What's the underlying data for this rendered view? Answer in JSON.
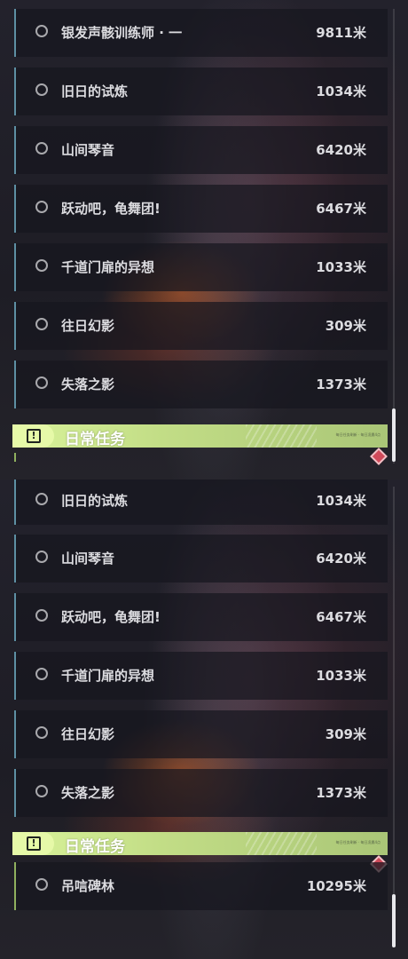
{
  "distance_unit": "米",
  "top_panel": {
    "quests": [
      {
        "name": "银发声骸训练师 · 一",
        "distance": "9811米"
      },
      {
        "name": "旧日的试炼",
        "distance": "1034米"
      },
      {
        "name": "山间琴音",
        "distance": "6420米"
      },
      {
        "name": "跃动吧，龟舞团!",
        "distance": "6467米"
      },
      {
        "name": "千道门扉的异想",
        "distance": "1033米"
      },
      {
        "name": "往日幻影",
        "distance": "309米"
      },
      {
        "name": "失落之影",
        "distance": "1373米"
      }
    ],
    "daily_section": {
      "title": "日常任务",
      "icon": "exclamation-square-icon",
      "subtitle": "每日任务刷新 · 每日凌晨4点"
    }
  },
  "bottom_panel": {
    "quests": [
      {
        "name": "旧日的试炼",
        "distance": "1034米"
      },
      {
        "name": "山间琴音",
        "distance": "6420米"
      },
      {
        "name": "跃动吧，龟舞团!",
        "distance": "6467米"
      },
      {
        "name": "千道门扉的异想",
        "distance": "1033米"
      },
      {
        "name": "往日幻影",
        "distance": "309米"
      },
      {
        "name": "失落之影",
        "distance": "1373米"
      }
    ],
    "daily_section": {
      "title": "日常任务",
      "icon": "exclamation-square-icon",
      "subtitle": "每日任务刷新 · 每日凌晨4点"
    },
    "daily_quests": [
      {
        "name": "吊唁碑林",
        "distance": "10295米"
      }
    ]
  },
  "colors": {
    "accent_green": "#d9f39a",
    "quest_bar_blue": "#5d8fa3",
    "daily_bar_green": "#8fb05e",
    "marker_red": "#d04a5a"
  }
}
